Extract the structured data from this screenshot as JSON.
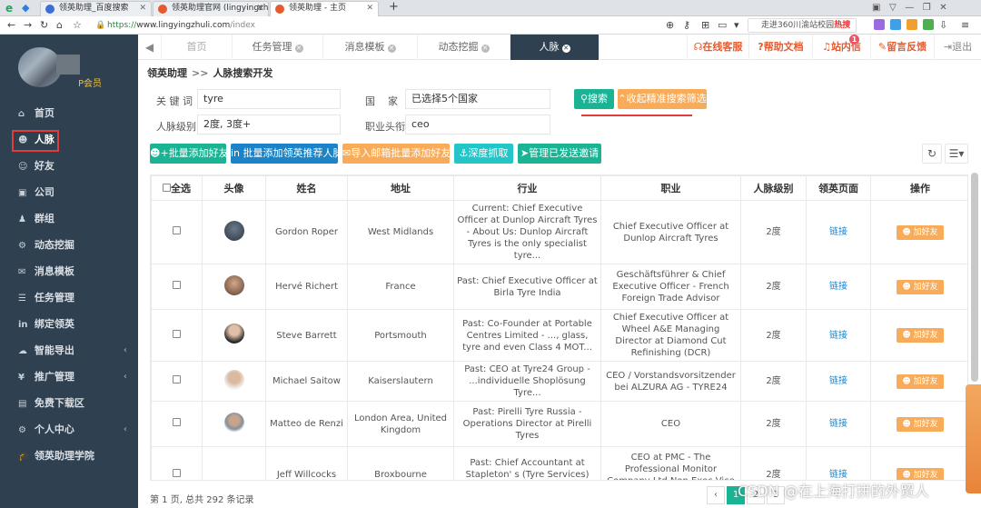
{
  "browser": {
    "tabs": [
      {
        "label": "领英助理_百度搜索",
        "active": false
      },
      {
        "label": "领英助理官网 (lingyingzhuli.",
        "active": false
      },
      {
        "label": "领英助理 - 主页",
        "active": true
      }
    ],
    "new_tab": "+",
    "url_prefix": "https://",
    "url_host": "www.lingyingzhuli.com",
    "url_path": "/index",
    "search_text": "走进360川渝站校园",
    "search_hot": "热搜"
  },
  "sidebar": {
    "member_label": "P会员",
    "items": [
      {
        "icon": "⌂",
        "label": "首页",
        "arrow": ""
      },
      {
        "icon": "☻",
        "label": "人脉",
        "arrow": ""
      },
      {
        "icon": "☺",
        "label": "好友",
        "arrow": ""
      },
      {
        "icon": "▣",
        "label": "公司",
        "arrow": ""
      },
      {
        "icon": "♟",
        "label": "群组",
        "arrow": ""
      },
      {
        "icon": "⚙",
        "label": "动态挖掘",
        "arrow": ""
      },
      {
        "icon": "✉",
        "label": "消息模板",
        "arrow": ""
      },
      {
        "icon": "☰",
        "label": "任务管理",
        "arrow": ""
      },
      {
        "icon": "in",
        "label": "绑定领英",
        "arrow": ""
      },
      {
        "icon": "☁",
        "label": "智能导出",
        "arrow": "‹"
      },
      {
        "icon": "¥",
        "label": "推广管理",
        "arrow": "‹"
      },
      {
        "icon": "▤",
        "label": "免费下载区",
        "arrow": ""
      },
      {
        "icon": "⚙",
        "label": "个人中心",
        "arrow": "‹"
      },
      {
        "icon": "🎓",
        "label": "领英助理学院",
        "arrow": ""
      }
    ]
  },
  "topnav": {
    "tabs": [
      {
        "label": "首页",
        "closable": false
      },
      {
        "label": "任务管理",
        "closable": true
      },
      {
        "label": "消息模板",
        "closable": true
      },
      {
        "label": "动态挖掘",
        "closable": true
      },
      {
        "label": "人脉",
        "closable": true
      }
    ],
    "right": [
      {
        "label": "在线客服"
      },
      {
        "label": "帮助文档"
      },
      {
        "label": "站内信",
        "badge": "1"
      },
      {
        "label": "留言反馈"
      },
      {
        "label": "退出"
      }
    ]
  },
  "breadcrumb": {
    "root": "领英助理",
    "sep": ">>",
    "current": "人脉搜索开发"
  },
  "search_form": {
    "keyword_label": "关 键 词",
    "keyword_value": "tyre",
    "country_label": "国    家",
    "country_value": "已选择5个国家",
    "level_label": "人脉级别",
    "level_value": "2度, 3度+",
    "title_label": "职业头衔",
    "title_value": "ceo",
    "search_btn": "搜索",
    "collapse_btn": "收起精准搜索筛选"
  },
  "toolbar": {
    "batch_add": "批量添加好友",
    "batch_recommend": "批量添加领英推荐人脉",
    "import_email": "导入邮箱批量添加好友",
    "deep_fetch": "深度抓取",
    "manage_invites": "管理已发送邀请"
  },
  "table": {
    "headers": [
      "全选",
      "头像",
      "姓名",
      "地址",
      "行业",
      "职业",
      "人脉级别",
      "领英页面",
      "操作"
    ],
    "rows": [
      {
        "name": "Gordon Roper",
        "address": "West Midlands",
        "industry": "Current: Chief Executive Officer at Dunlop Aircraft Tyres - About Us: Dunlop Aircraft Tyres is the only specialist tyre...",
        "job": "Chief Executive Officer at Dunlop Aircraft Tyres",
        "level": "2度",
        "link": "链接",
        "action": "加好友"
      },
      {
        "name": "Hervé Richert",
        "address": "France",
        "industry": "Past: Chief Executive Officer at Birla Tyre India",
        "job": "Geschäftsführer & Chief Executive Officer - French Foreign Trade Advisor",
        "level": "2度",
        "link": "链接",
        "action": "加好友"
      },
      {
        "name": "Steve Barrett",
        "address": "Portsmouth",
        "industry": "Past: Co-Founder at Portable Centres Limited - ..., glass, tyre and even Class 4 MOT...",
        "job": "Chief Executive Officer at Wheel A&E Managing Director at Diamond Cut Refinishing (DCR)",
        "level": "2度",
        "link": "链接",
        "action": "加好友"
      },
      {
        "name": "Michael Saitow",
        "address": "Kaiserslautern",
        "industry": "Past: CEO at Tyre24 Group - ...individuelle Shoplösung Tyre...",
        "job": "CEO / Vorstandsvorsitzender bei ALZURA AG - TYRE24",
        "level": "2度",
        "link": "链接",
        "action": "加好友"
      },
      {
        "name": "Matteo de Renzi",
        "address": "London Area, United Kingdom",
        "industry": "Past: Pirelli Tyre Russia - Operations Director at Pirelli Tyres",
        "job": "CEO",
        "level": "2度",
        "link": "链接",
        "action": "加好友"
      },
      {
        "name": "Jeff Willcocks",
        "address": "Broxbourne",
        "industry": "Past: Chief Accountant at Stapleton' s (Tyre Services) Ltd.",
        "job": "CEO at PMC - The Professional Monitor Company Ltd,Non Exec,Vice Chair,Mentor, Turnarounds",
        "level": "2度",
        "link": "链接",
        "action": "加好友"
      }
    ]
  },
  "footer": {
    "summary": "第 1 页, 总共 292 条记录",
    "pages": [
      "‹",
      "1",
      "2",
      "3"
    ]
  },
  "watermark": "CSDN @在上海打拼的外贸人"
}
